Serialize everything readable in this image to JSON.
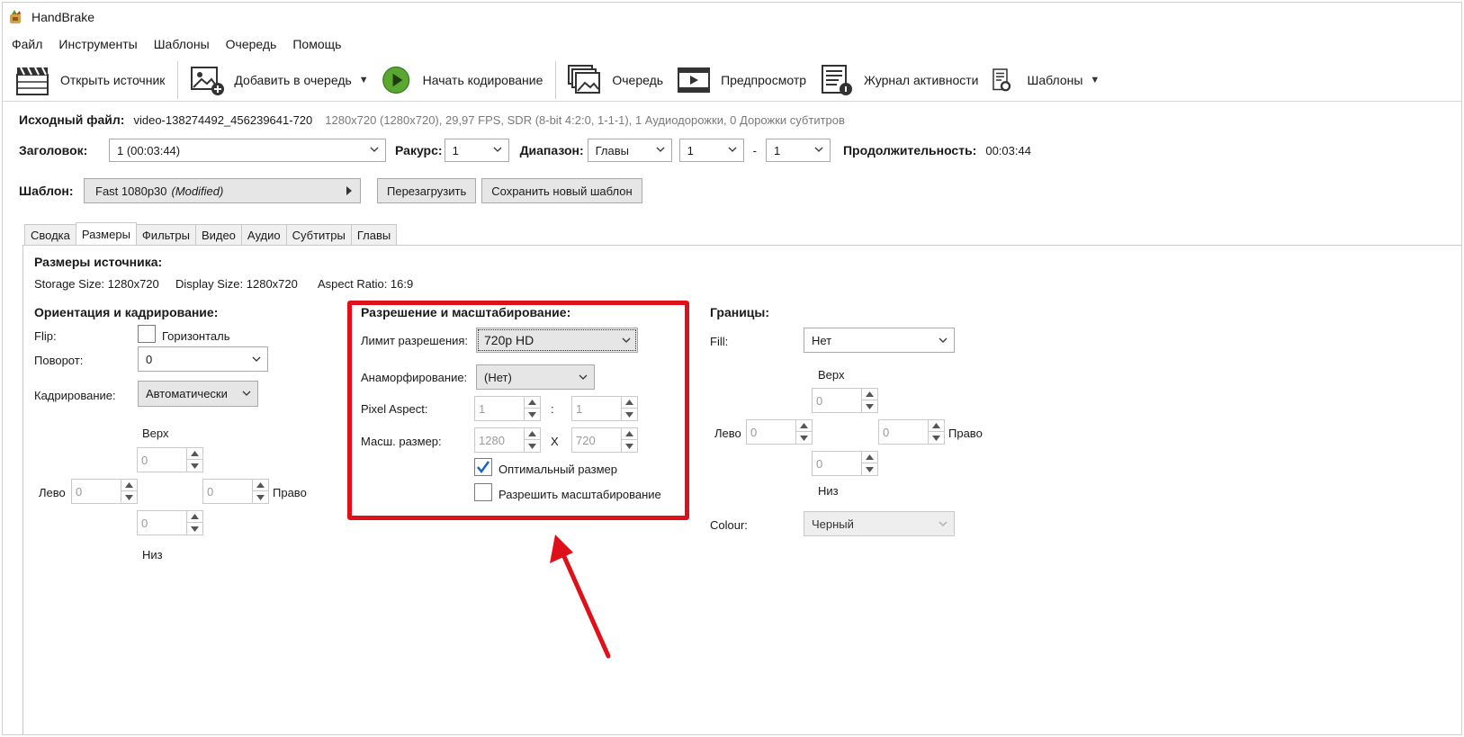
{
  "window": {
    "title": "HandBrake"
  },
  "menu": [
    "Файл",
    "Инструменты",
    "Шаблоны",
    "Очередь",
    "Помощь"
  ],
  "toolbar": {
    "open_source": "Открыть источник",
    "add_to_queue": "Добавить в очередь",
    "start_encode": "Начать кодирование",
    "queue": "Очередь",
    "preview": "Предпросмотр",
    "activity_log": "Журнал активности",
    "presets": "Шаблоны"
  },
  "source": {
    "label": "Исходный файл:",
    "filename": "video-138274492_456239641-720",
    "meta": "1280x720 (1280x720), 29,97 FPS, SDR (8-bit 4:2:0, 1-1-1), 1 Аудиодорожки, 0 Дорожки субтитров"
  },
  "title_row": {
    "title_label": "Заголовок:",
    "title_value": "1  (00:03:44)",
    "angle_label": "Ракурс:",
    "angle_value": "1",
    "range_label": "Диапазон:",
    "range_type": "Главы",
    "range_from": "1",
    "range_sep": "-",
    "range_to": "1",
    "duration_label": "Продолжительность:",
    "duration_value": "00:03:44"
  },
  "preset_row": {
    "label": "Шаблон:",
    "value": "Fast 1080p30",
    "modified": "(Modified)",
    "reload": "Перезагрузить",
    "save_new": "Сохранить новый шаблон"
  },
  "tabs": [
    {
      "label": "Сводка",
      "active": false
    },
    {
      "label": "Размеры",
      "active": true
    },
    {
      "label": "Фильтры",
      "active": false
    },
    {
      "label": "Видео",
      "active": false
    },
    {
      "label": "Аудио",
      "active": false
    },
    {
      "label": "Субтитры",
      "active": false
    },
    {
      "label": "Главы",
      "active": false
    }
  ],
  "dimensions": {
    "source_title": "Размеры источника:",
    "storage": "Storage Size: 1280x720",
    "display": "Display Size: 1280x720",
    "aspect": "Aspect Ratio: 16:9"
  },
  "orientation": {
    "title": "Ориентация и кадрирование:",
    "flip_label": "Flip:",
    "flip_option": "Горизонталь",
    "rotate_label": "Поворот:",
    "rotate_value": "0",
    "crop_label": "Кадрирование:",
    "crop_value": "Автоматически",
    "top_label": "Верх",
    "top_value": "0",
    "left_label": "Лево",
    "left_value": "0",
    "right_value": "0",
    "right_label": "Право",
    "bottom_value": "0",
    "bottom_label": "Низ"
  },
  "resolution": {
    "title": "Разрешение и масштабирование:",
    "limit_label": "Лимит разрешения:",
    "limit_value": "720p HD",
    "anamorphic_label": "Анаморфирование:",
    "anamorphic_value": "(Нет)",
    "pixel_aspect_label": "Pixel Aspect:",
    "pixel_aspect_w": "1",
    "pixel_aspect_sep": ":",
    "pixel_aspect_h": "1",
    "scaled_label": "Масш. размер:",
    "scaled_w": "1280",
    "scaled_sep": "X",
    "scaled_h": "720",
    "optimal_label": "Оптимальный размер",
    "optimal_checked": true,
    "allow_upscale_label": "Разрешить масштабирование",
    "allow_upscale_checked": false
  },
  "borders": {
    "title": "Границы:",
    "fill_label": "Fill:",
    "fill_value": "Нет",
    "top_label": "Верх",
    "top_value": "0",
    "left_label": "Лево",
    "left_value": "0",
    "right_value": "0",
    "right_label": "Право",
    "bottom_value": "0",
    "bottom_label": "Низ",
    "colour_label": "Colour:",
    "colour_value": "Черный"
  },
  "colors": {
    "annotation_red": "#e0101a",
    "check_blue": "#1565c0",
    "play_green": "#5aa832"
  }
}
